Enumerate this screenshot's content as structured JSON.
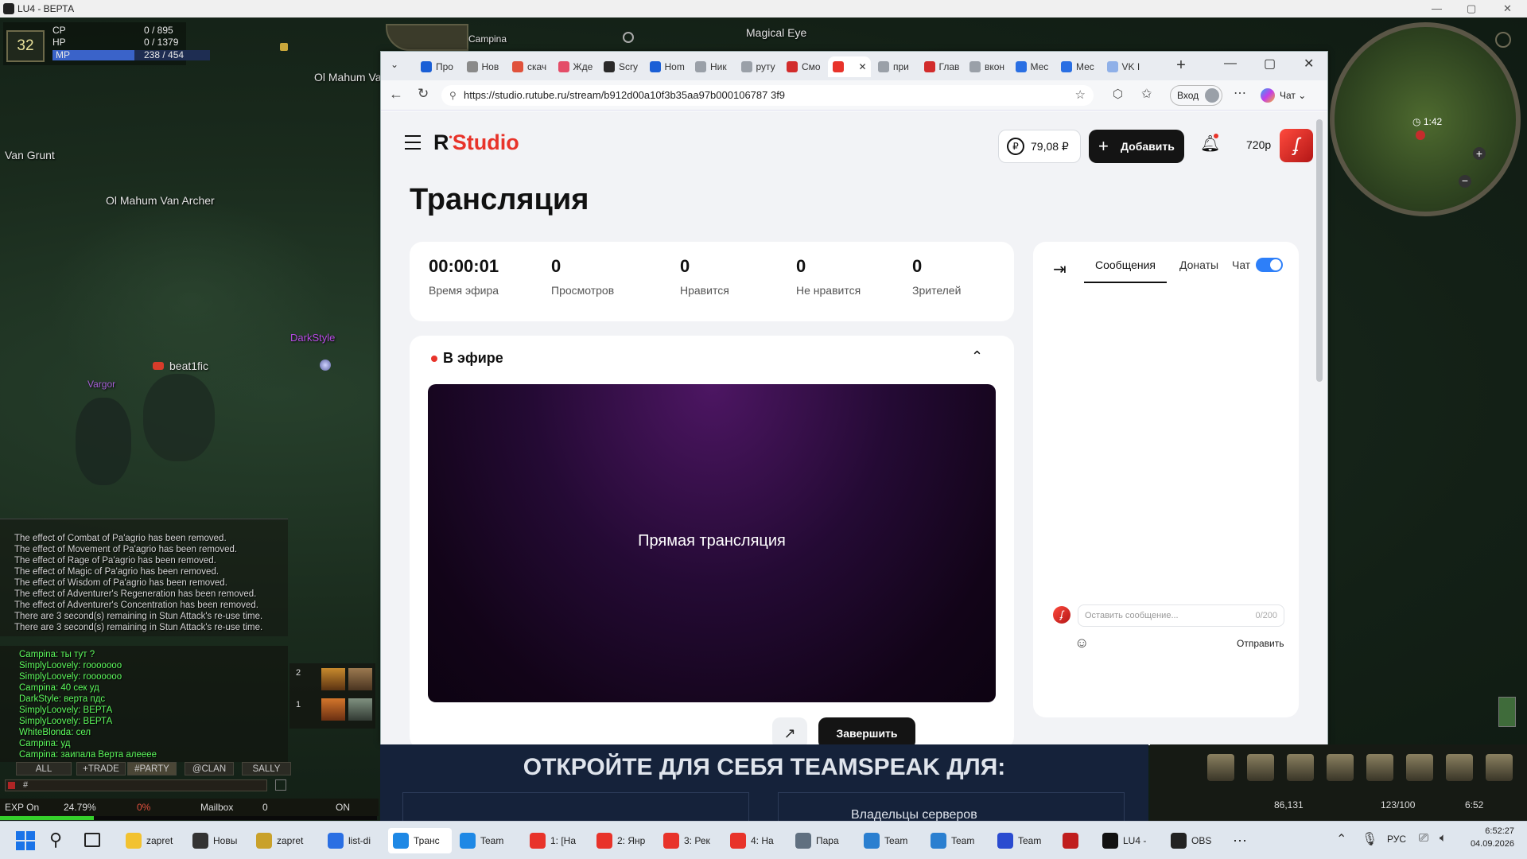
{
  "window": {
    "title": "LU4 - ВЕРТА"
  },
  "game": {
    "level": "32",
    "cp_label": "CP",
    "cp_value": "0 / 895",
    "hp_label": "HP",
    "hp_value": "0 / 1379",
    "mp_label": "MP",
    "mp_value": "238 / 454",
    "mp_fill": 0.52,
    "npcs": [
      "Van Grunt",
      "Ol Mahum Van Archer",
      "Ol Mahum Va",
      "Campina",
      "Magical Eye",
      "beat1fic",
      "DarkStyle",
      "Vargor"
    ],
    "system_messages": [
      "The effect of Combat of Pa'agrio has been removed.",
      "The effect of Movement of Pa'agrio has been removed.",
      "The effect of Rage of Pa'agrio has been removed.",
      "The effect of Magic of Pa'agrio has been removed.",
      "The effect of Wisdom of Pa'agrio has been removed.",
      "The effect of Adventurer's Regeneration has been removed.",
      "The effect of Adventurer's Concentration has been removed.",
      "There are 3 second(s) remaining in Stun Attack's re-use time.",
      "There are 3 second(s) remaining in Stun Attack's re-use time."
    ],
    "chat_messages": [
      "Campina: ты тут ?",
      "SimplyLoovely: rooooooo",
      "SimplyLoovely: rooooooo",
      "Campina: 40 сек уд",
      "DarkStyle: верта пдс",
      "SimplyLoovely: ВЕРТА",
      "SimplyLoovely: ВЕРТА",
      "WhiteBlonda: сел",
      "Campina: уд",
      "Campina: заипала Верта алееее"
    ],
    "chat_tabs": [
      "ALL",
      "+TRADE",
      "#PARTY",
      "@CLAN",
      "SALLY"
    ],
    "chat_input": "#",
    "exp_label": "EXP On",
    "exp_value": "24.79%",
    "exp_pct2": "0%",
    "mailbox": "Mailbox",
    "mail_count": "0",
    "on_label": "ON",
    "minimap_time": "1:42",
    "coords": "86,131",
    "weight": "123/100",
    "game_time": "6:52",
    "shortcut_rows": [
      "2",
      "1"
    ]
  },
  "browser": {
    "tabs": [
      "Про",
      "Нов",
      "скач",
      "Жде",
      "Scry",
      "Hom",
      "Ник",
      "руту",
      "Смо",
      "",
      "при",
      "Глав",
      "вкон",
      "Мес",
      "Мес",
      "VK I"
    ],
    "url": "https://studio.rutube.ru/stream/b912d00a10f3b35aa97b000106787 3f9",
    "login": "Вход",
    "copilot": "Чат"
  },
  "studio": {
    "brand": "Studio",
    "balance": "79,08 ₽",
    "add_label": "Добавить",
    "quality": "720p",
    "page_title": "Трансляция",
    "stats": [
      {
        "value": "00:00:01",
        "label": "Время эфира"
      },
      {
        "value": "0",
        "label": "Просмотров"
      },
      {
        "value": "0",
        "label": "Нравится"
      },
      {
        "value": "0",
        "label": "Не нравится"
      },
      {
        "value": "0",
        "label": "Зрителей"
      }
    ],
    "live_label": "В эфире",
    "preview_text": "Прямая трансляция",
    "finish_label": "Завершить",
    "chat_tab_messages": "Сообщения",
    "chat_tab_donates": "Донаты",
    "chat_toggle_label": "Чат",
    "chat_placeholder": "Оставить сообщение...",
    "chat_counter": "0/200",
    "send_label": "Отправить"
  },
  "teamspeak": {
    "headline": "ОТКРОЙТЕ ДЛЯ СЕБЯ TEAMSPEAK ДЛЯ:",
    "sub": "Владельцы серверов"
  },
  "taskbar": {
    "items": [
      "zapret",
      "Новы",
      "zapret",
      "list-di",
      "Транс",
      "Team",
      "1: [На",
      "2: Янр",
      "3: Рек",
      "4: На",
      "Пара",
      "Team",
      "Team",
      "Team",
      "",
      "LU4 -",
      "OBS"
    ],
    "lang": "РУС",
    "time": "6:52:27",
    "date": "04.09.2026"
  },
  "colors": {
    "brand_red": "#e8332a",
    "toggle_blue": "#2d7ff9",
    "game_chat_green": "#5dfb5d"
  }
}
